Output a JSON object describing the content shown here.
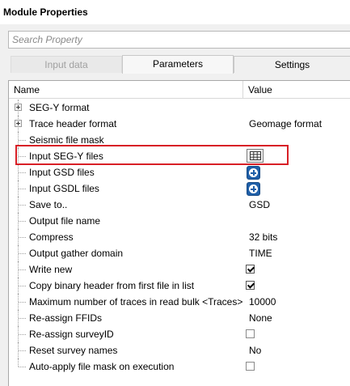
{
  "title": "Module Properties",
  "search": {
    "placeholder": "Search Property"
  },
  "tabs": [
    {
      "label": "Input data",
      "state": "disabled"
    },
    {
      "label": "Parameters",
      "state": "active"
    },
    {
      "label": "Settings",
      "state": "normal"
    }
  ],
  "columns": {
    "name": "Name",
    "value": "Value"
  },
  "rows": [
    {
      "label": "SEG-Y format",
      "value": "",
      "expandable": true
    },
    {
      "label": "Trace header format",
      "value": "Geomage format",
      "expandable": true
    },
    {
      "label": "Seismic file mask",
      "value": ""
    },
    {
      "label": "Input SEG-Y files",
      "value": "",
      "control": "grid-icon"
    },
    {
      "label": "Input GSD files",
      "value": "",
      "control": "plus-icon"
    },
    {
      "label": "Input GSDL files",
      "value": "",
      "control": "plus-icon"
    },
    {
      "label": "Save to..",
      "value": "GSD"
    },
    {
      "label": "Output file name",
      "value": ""
    },
    {
      "label": "Compress",
      "value": "32 bits"
    },
    {
      "label": "Output gather domain",
      "value": "TIME"
    },
    {
      "label": "Write new",
      "value": "",
      "checked": true
    },
    {
      "label": "Copy binary header from first file in list",
      "value": "",
      "checked": true
    },
    {
      "label": "Maximum number of traces in read bulk <Traces>",
      "value": "10000"
    },
    {
      "label": "Re-assign FFIDs",
      "value": "None"
    },
    {
      "label": "Re-assign surveyID",
      "value": "",
      "checked": false
    },
    {
      "label": "Reset survey names",
      "value": "No"
    },
    {
      "label": "Auto-apply file mask on execution",
      "value": "",
      "checked": false
    }
  ],
  "colors": {
    "highlight": "#d81f26",
    "accent": "#1f5fa8"
  }
}
